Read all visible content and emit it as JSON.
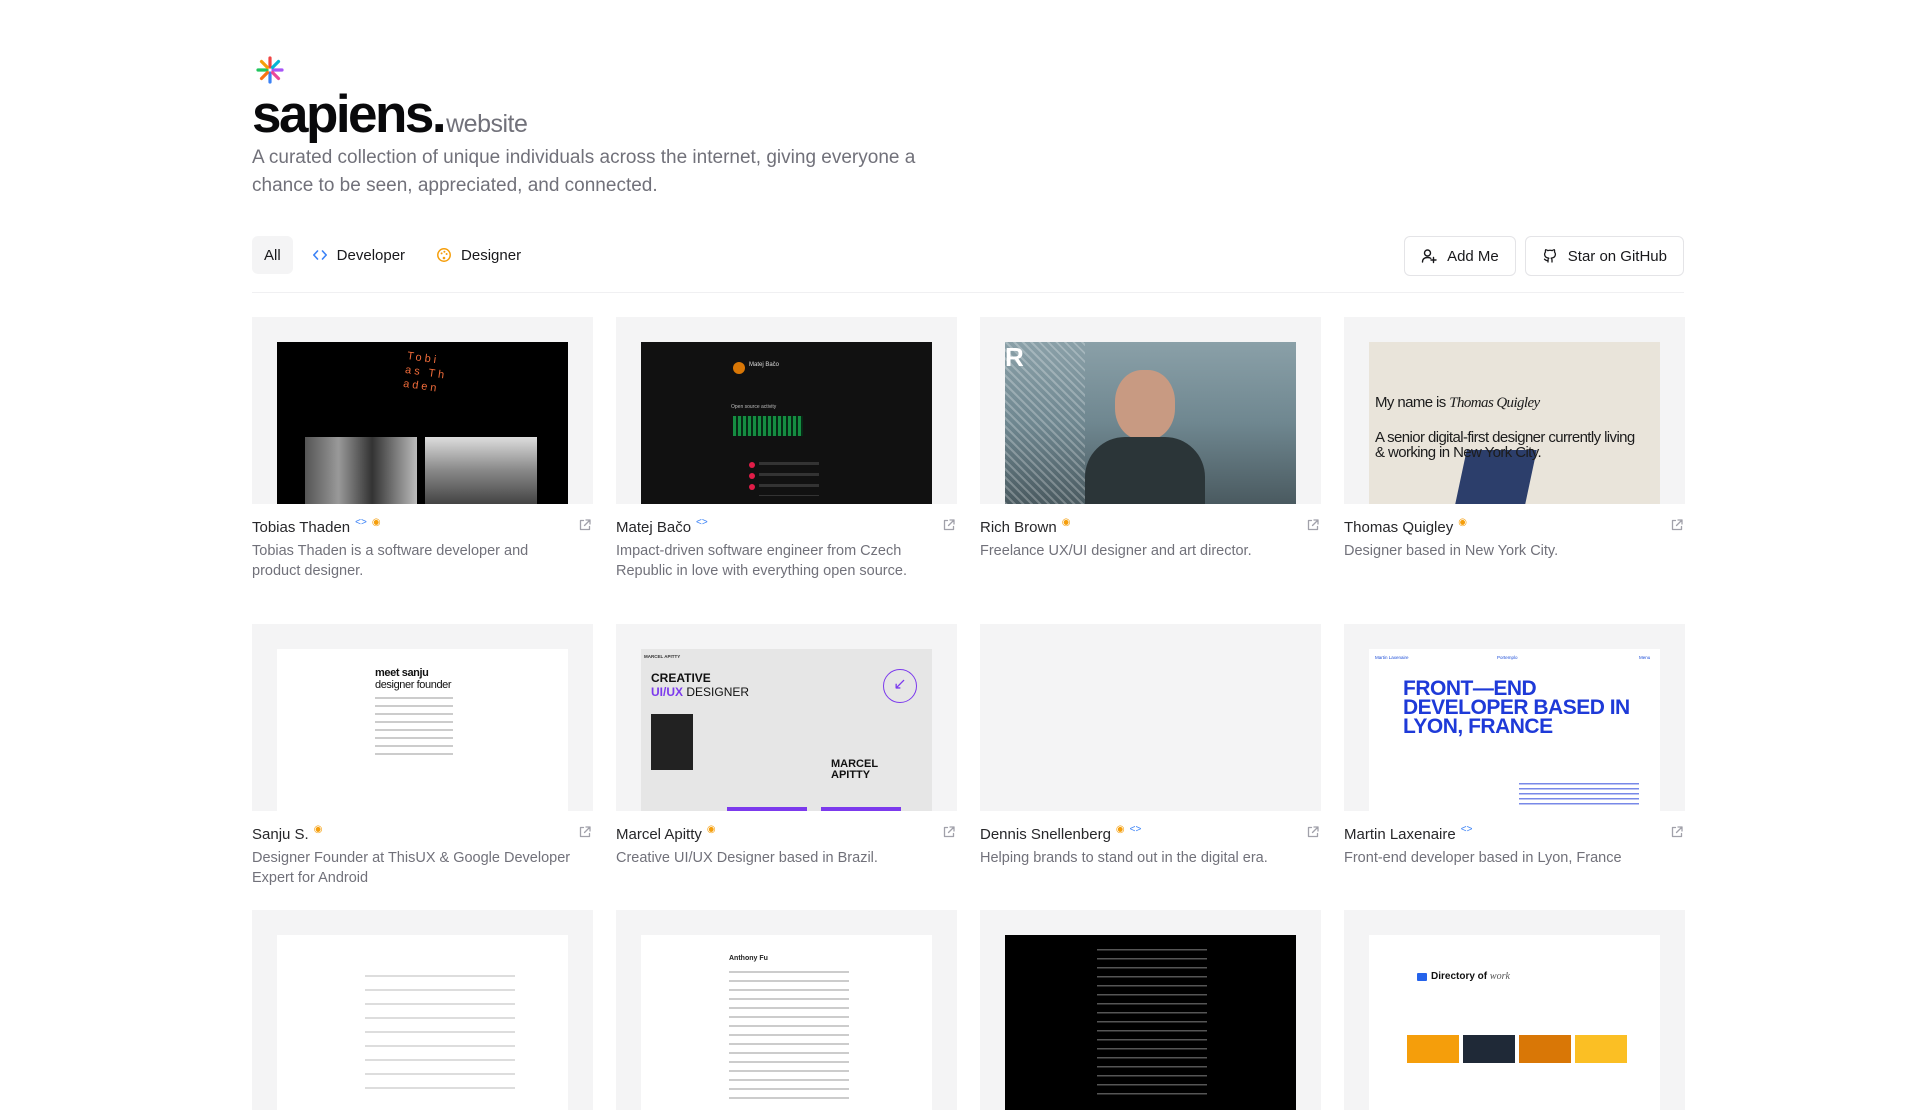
{
  "brand": {
    "name": "sapiens.",
    "suffix": "website",
    "tagline": "A curated collection of unique individuals across the internet, giving everyone a chance to be seen, appreciated, and connected."
  },
  "filters": [
    {
      "label": "All",
      "active": true,
      "icon": ""
    },
    {
      "label": "Developer",
      "active": false,
      "icon": "code-icon"
    },
    {
      "label": "Designer",
      "active": false,
      "icon": "palette-icon"
    }
  ],
  "actions": {
    "add_me": "Add Me",
    "star": "Star on GitHub"
  },
  "people": [
    {
      "name": "Tobias Thaden",
      "tags": [
        "dev",
        "des"
      ],
      "desc": "Tobias Thaden is a software developer and product designer."
    },
    {
      "name": "Matej Bačo",
      "tags": [
        "dev"
      ],
      "desc": "Impact-driven software engineer from Czech Republic in love with everything open source."
    },
    {
      "name": "Rich Brown",
      "tags": [
        "des"
      ],
      "desc": "Freelance UX/UI designer and art director."
    },
    {
      "name": "Thomas Quigley",
      "tags": [
        "des"
      ],
      "desc": "Designer based in New York City."
    },
    {
      "name": "Sanju S.",
      "tags": [
        "des"
      ],
      "desc": "Designer Founder at ThisUX & Google Developer Expert for Android"
    },
    {
      "name": "Marcel Apitty",
      "tags": [
        "des"
      ],
      "desc": "Creative UI/UX Designer based in Brazil."
    },
    {
      "name": "Dennis Snellenberg",
      "tags": [
        "des",
        "dev"
      ],
      "desc": "Helping brands to stand out in the digital era."
    },
    {
      "name": "Martin Laxenaire",
      "tags": [
        "dev"
      ],
      "desc": "Front-end developer based in Lyon, France"
    }
  ],
  "thumb_text": {
    "tobias": "Tobi as Th aden",
    "matej_name": "Matej Bačo",
    "matej_activity": "Open source activity",
    "quigley_line1": "My name is",
    "quigley_name": "Thomas Quigley",
    "quigley_line2": "A senior digital-first designer currently living & working in New York City.",
    "sanju_line1": "meet sanju",
    "sanju_line2": "designer founder",
    "marcel_creative": "CREATIVE",
    "marcel_uiux": "UI/UX",
    "marcel_designer": "DESIGNER",
    "marcel_name": "MARCEL APITTY",
    "marcel_top": "MARCEL APITTY",
    "martin_headline": "FRONT—END DEVELOPER BASED IN LYON, FRANCE",
    "martin_left": "Martin Laxenaire",
    "martin_mid": "Portemplo",
    "martin_right": "Menu",
    "anthony_name": "Anthony Fu",
    "directory_title": "Directory of",
    "directory_word": "work"
  },
  "colors": {
    "accent_blue": "#3b82f6",
    "accent_amber": "#f59e0b",
    "text_muted": "#71717a"
  }
}
